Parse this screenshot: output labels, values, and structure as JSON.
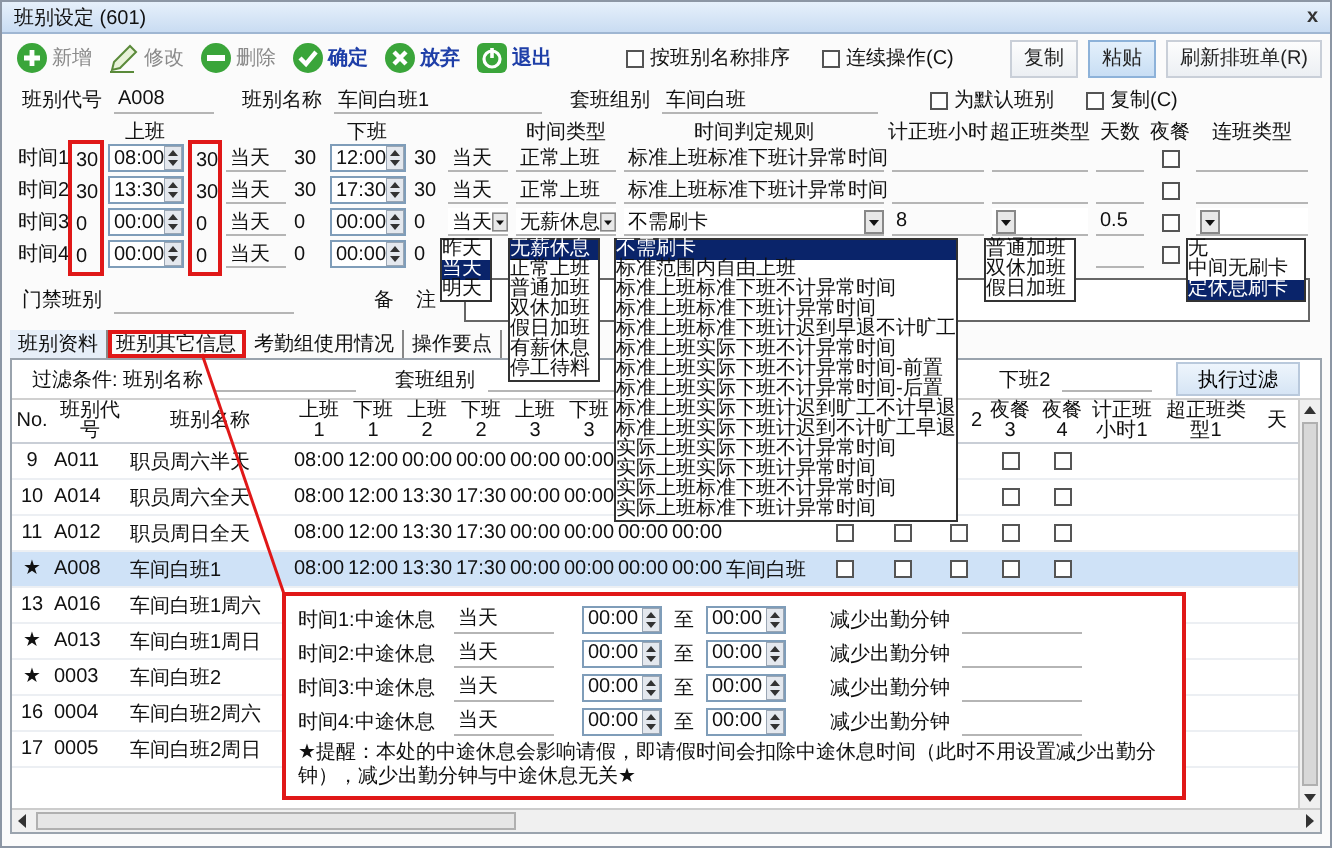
{
  "window": {
    "title": "班别设定 (601)",
    "close": "x"
  },
  "toolbar": {
    "buttons": [
      {
        "label": "新增",
        "kind": "plus",
        "disabled": true
      },
      {
        "label": "修改",
        "kind": "pencil",
        "disabled": true
      },
      {
        "label": "删除",
        "kind": "minus",
        "disabled": true
      },
      {
        "label": "确定",
        "kind": "check",
        "disabled": false
      },
      {
        "label": "放弃",
        "kind": "cross",
        "disabled": false
      },
      {
        "label": "退出",
        "kind": "power",
        "disabled": false
      }
    ],
    "options": [
      {
        "label": "按班别名称排序",
        "checked": false
      },
      {
        "label": "连续操作(C)",
        "checked": false
      }
    ],
    "actions": [
      {
        "label": "复制",
        "hover": false
      },
      {
        "label": "粘贴",
        "hover": true
      },
      {
        "label": "刷新排班单(R)",
        "hover": false
      }
    ]
  },
  "form": {
    "fields": [
      {
        "label": "班别代号",
        "value": "A008"
      },
      {
        "label": "班别名称",
        "value": "车间白班1"
      },
      {
        "label": "套班组别",
        "value": "车间白班"
      }
    ],
    "options": [
      {
        "label": "为默认班别",
        "checked": false
      },
      {
        "label": "复制(C)",
        "checked": false
      }
    ]
  },
  "times": {
    "headers": [
      "上班",
      "下班",
      "时间类型",
      "时间判定规则",
      "计正班小时",
      "超正班类型",
      "天数",
      "夜餐",
      "连班类型"
    ],
    "frame_before": true,
    "frame_after": true,
    "rows": [
      {
        "kind": "text",
        "label": "时间1",
        "in_before": "30",
        "in_time": "08:00",
        "in_after": "30",
        "in_day": "当天",
        "out_before": "30",
        "out_time": "12:00",
        "out_after": "30",
        "out_day": "当天",
        "type": "正常上班",
        "rule": "标准上班标准下班计异常时间",
        "night_meal": false
      },
      {
        "kind": "text",
        "label": "时间2",
        "in_before": "30",
        "in_time": "13:30",
        "in_after": "30",
        "in_day": "当天",
        "out_before": "30",
        "out_time": "17:30",
        "out_after": "30",
        "out_day": "当天",
        "type": "正常上班",
        "rule": "标准上班标准下班计异常时间",
        "night_meal": false
      },
      {
        "kind": "combo",
        "label": "时间3",
        "in_before": "0",
        "in_time": "00:00",
        "in_after": "0",
        "in_day": "当天",
        "out_before": "0",
        "out_time": "00:00",
        "out_after": "0",
        "out_day": "当天",
        "type": "无薪休息",
        "rule": "不需刷卡",
        "hours": "8",
        "days": "0.5",
        "night_meal": false
      },
      {
        "kind": "under_lists",
        "label": "时间4",
        "in_before": "0",
        "in_time": "00:00",
        "in_after": "0",
        "in_day": "当天",
        "out_before": "0",
        "out_time": "00:00",
        "out_after": "0",
        "night_meal": false
      }
    ],
    "day_list": [
      {
        "label": "昨天",
        "selected": false
      },
      {
        "label": "当天",
        "selected": true
      },
      {
        "label": "明天",
        "selected": false
      }
    ],
    "type_list": [
      {
        "label": "无薪休息",
        "selected": true
      },
      {
        "label": "正常上班",
        "selected": false
      },
      {
        "label": "普通加班",
        "selected": false
      },
      {
        "label": "双休加班",
        "selected": false
      },
      {
        "label": "假日加班",
        "selected": false
      },
      {
        "label": "有薪休息",
        "selected": false
      },
      {
        "label": "停工待料",
        "selected": false
      }
    ],
    "rule_list": [
      {
        "label": "不需刷卡",
        "selected": true
      },
      {
        "label": "标准范围内自由上班",
        "selected": false
      },
      {
        "label": "标准上班标准下班不计异常时间",
        "selected": false
      },
      {
        "label": "标准上班标准下班计异常时间",
        "selected": false
      },
      {
        "label": "标准上班标准下班计迟到早退不计旷工",
        "selected": false
      },
      {
        "label": "标准上班实际下班不计异常时间",
        "selected": false
      },
      {
        "label": "标准上班实际下班不计异常时间-前置",
        "selected": false
      },
      {
        "label": "标准上班实际下班不计异常时间-后置",
        "selected": false
      },
      {
        "label": "标准上班实际下班计迟到旷工不计早退",
        "selected": false
      },
      {
        "label": "标准上班实际下班计迟到不计旷工早退",
        "selected": false
      },
      {
        "label": "实际上班实际下班不计异常时间",
        "selected": false
      },
      {
        "label": "实际上班实际下班计异常时间",
        "selected": false
      },
      {
        "label": "实际上班标准下班不计异常时间",
        "selected": false
      },
      {
        "label": "实际上班标准下班计异常时间",
        "selected": false
      }
    ],
    "overtime_list": [
      {
        "label": "普通加班",
        "selected": false
      },
      {
        "label": "双休加班",
        "selected": false
      },
      {
        "label": "假日加班",
        "selected": false
      }
    ],
    "link_list": [
      {
        "label": "无",
        "selected": false
      },
      {
        "label": "中间无刷卡",
        "selected": false
      },
      {
        "label": "定休息刷卡",
        "selected": true
      }
    ]
  },
  "gate": {
    "label": "门禁班别",
    "note_label": "备 注"
  },
  "tabs": [
    {
      "label": "班别资料",
      "selected": true,
      "framed": false
    },
    {
      "label": "班别其它信息",
      "selected": false,
      "framed": true
    },
    {
      "label": "考勤组使用情况",
      "selected": false,
      "framed": false
    },
    {
      "label": "操作要点",
      "selected": false,
      "framed": false
    }
  ],
  "table": {
    "filter": {
      "name_label": "过滤条件: 班别名称",
      "group_label": "套班组别",
      "out2_label": "下班2",
      "button": "执行过滤"
    },
    "headers": {
      "no": "No.",
      "code": "班别代号",
      "name": "班别名称",
      "in1": "上班1",
      "out1": "下班1",
      "in2": "上班2",
      "out2": "下班2",
      "in3": "上班3",
      "out3": "下班3",
      "cb3": "2",
      "cb4": "夜餐3",
      "cb5": "夜餐4",
      "hours1": "计正班小时1",
      "ot1": "超正班类型1",
      "day1": "天"
    },
    "rows": [
      {
        "no": "9",
        "code": "A011",
        "name": "职员周六半天",
        "in1": "08:00",
        "out1": "12:00",
        "in2": "00:00",
        "out2": "00:00",
        "in3": "00:00",
        "out3": "00:00",
        "cb4": false,
        "cb5": false,
        "selected": false
      },
      {
        "no": "10",
        "code": "A014",
        "name": "职员周六全天",
        "in1": "08:00",
        "out1": "12:00",
        "in2": "13:30",
        "out2": "17:30",
        "in3": "00:00",
        "out3": "00:00",
        "cb4": false,
        "cb5": false,
        "selected": false
      },
      {
        "no": "11",
        "code": "A012",
        "name": "职员周日全天",
        "in1": "08:00",
        "out1": "12:00",
        "in2": "13:30",
        "out2": "17:30",
        "in3": "00:00",
        "out3": "00:00",
        "in4": "00:00",
        "out4": "00:00",
        "cb1": false,
        "cb2": false,
        "cb3": false,
        "cb4": false,
        "cb5": false,
        "selected": false
      },
      {
        "no": "★",
        "code": "A008",
        "name": "车间白班1",
        "in1": "08:00",
        "out1": "12:00",
        "in2": "13:30",
        "out2": "17:30",
        "in3": "00:00",
        "out3": "00:00",
        "in4": "00:00",
        "out4": "00:00",
        "group": "车间白班",
        "cb1": false,
        "cb2": false,
        "cb3": false,
        "cb4": false,
        "cb5": false,
        "selected": true
      },
      {
        "no": "13",
        "code": "A016",
        "name": "车间白班1周六",
        "selected": false
      },
      {
        "no": "★",
        "code": "A013",
        "name": "车间白班1周日",
        "selected": false
      },
      {
        "no": "★",
        "code": "0003",
        "name": "车间白班2",
        "selected": false
      },
      {
        "no": "16",
        "code": "0004",
        "name": "车间白班2周六",
        "selected": false
      },
      {
        "no": "17",
        "code": "0005",
        "name": "车间白班2周日",
        "selected": false
      }
    ]
  },
  "break_popup": {
    "pointer": true,
    "rows": [
      {
        "label": "时间1:中途休息",
        "day": "当天",
        "from": "00:00",
        "to_label": "至",
        "to": "00:00",
        "minus_label": "减少出勤分钟"
      },
      {
        "label": "时间2:中途休息",
        "day": "当天",
        "from": "00:00",
        "to_label": "至",
        "to": "00:00",
        "minus_label": "减少出勤分钟"
      },
      {
        "label": "时间3:中途休息",
        "day": "当天",
        "from": "00:00",
        "to_label": "至",
        "to": "00:00",
        "minus_label": "减少出勤分钟"
      },
      {
        "label": "时间4:中途休息",
        "day": "当天",
        "from": "00:00",
        "to_label": "至",
        "to": "00:00",
        "minus_label": "减少出勤分钟"
      }
    ],
    "note": "★提醒：本处的中途休息会影响请假，即请假时间会扣除中途休息时间（此时不用设置减少出勤分钟），减少出勤分钟与中途休息无关★"
  }
}
